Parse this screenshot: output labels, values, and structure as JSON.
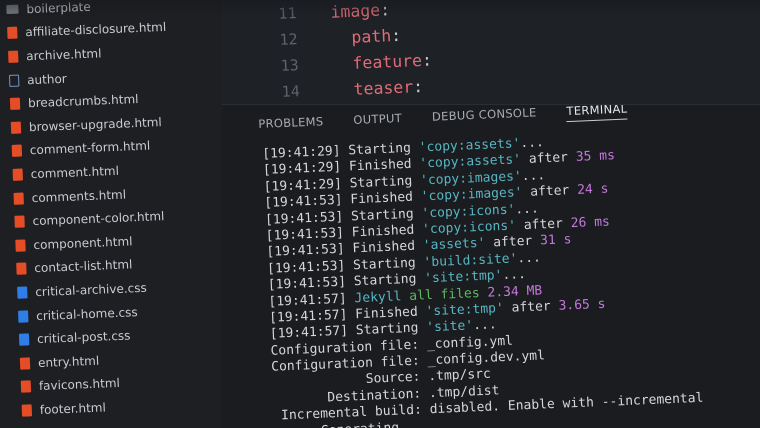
{
  "sidebar": {
    "files": [
      {
        "name": "boilerplate",
        "type": "folder"
      },
      {
        "name": "affiliate-disclosure.html",
        "type": "html"
      },
      {
        "name": "archive.html",
        "type": "html"
      },
      {
        "name": "author",
        "type": "file"
      },
      {
        "name": "breadcrumbs.html",
        "type": "html"
      },
      {
        "name": "browser-upgrade.html",
        "type": "html"
      },
      {
        "name": "comment-form.html",
        "type": "html"
      },
      {
        "name": "comment.html",
        "type": "html"
      },
      {
        "name": "comments.html",
        "type": "html"
      },
      {
        "name": "component-color.html",
        "type": "html"
      },
      {
        "name": "component.html",
        "type": "html"
      },
      {
        "name": "contact-list.html",
        "type": "html"
      },
      {
        "name": "critical-archive.css",
        "type": "css"
      },
      {
        "name": "critical-home.css",
        "type": "css"
      },
      {
        "name": "critical-post.css",
        "type": "css"
      },
      {
        "name": "entry.html",
        "type": "html"
      },
      {
        "name": "favicons.html",
        "type": "html"
      },
      {
        "name": "footer.html",
        "type": "html"
      }
    ]
  },
  "editor": {
    "lines": [
      {
        "num": "11",
        "key": "image",
        "indent": ""
      },
      {
        "num": "12",
        "key": "path",
        "indent": "  "
      },
      {
        "num": "13",
        "key": "feature",
        "indent": "  "
      },
      {
        "num": "14",
        "key": "teaser",
        "indent": "  "
      }
    ]
  },
  "panel": {
    "tabs": [
      {
        "label": "PROBLEMS",
        "active": false
      },
      {
        "label": "OUTPUT",
        "active": false
      },
      {
        "label": "DEBUG CONSOLE",
        "active": false
      },
      {
        "label": "TERMINAL",
        "active": true
      }
    ],
    "terminal_lines": [
      [
        {
          "t": "[19:41:29] ",
          "c": "ts"
        },
        {
          "t": "Starting ",
          "c": "ts"
        },
        {
          "t": "'copy:assets'",
          "c": "task"
        },
        {
          "t": "...",
          "c": "ts"
        }
      ],
      [
        {
          "t": "[19:41:29] ",
          "c": "ts"
        },
        {
          "t": "Finished ",
          "c": "ts"
        },
        {
          "t": "'copy:assets'",
          "c": "task"
        },
        {
          "t": " after ",
          "c": "ts"
        },
        {
          "t": "35 ms",
          "c": "num"
        }
      ],
      [
        {
          "t": "[19:41:29] ",
          "c": "ts"
        },
        {
          "t": "Starting ",
          "c": "ts"
        },
        {
          "t": "'copy:images'",
          "c": "task"
        },
        {
          "t": "...",
          "c": "ts"
        }
      ],
      [
        {
          "t": "[19:41:53] ",
          "c": "ts"
        },
        {
          "t": "Finished ",
          "c": "ts"
        },
        {
          "t": "'copy:images'",
          "c": "task"
        },
        {
          "t": " after ",
          "c": "ts"
        },
        {
          "t": "24 s",
          "c": "num"
        }
      ],
      [
        {
          "t": "[19:41:53] ",
          "c": "ts"
        },
        {
          "t": "Starting ",
          "c": "ts"
        },
        {
          "t": "'copy:icons'",
          "c": "task"
        },
        {
          "t": "...",
          "c": "ts"
        }
      ],
      [
        {
          "t": "[19:41:53] ",
          "c": "ts"
        },
        {
          "t": "Finished ",
          "c": "ts"
        },
        {
          "t": "'copy:icons'",
          "c": "task"
        },
        {
          "t": " after ",
          "c": "ts"
        },
        {
          "t": "26 ms",
          "c": "num"
        }
      ],
      [
        {
          "t": "[19:41:53] ",
          "c": "ts"
        },
        {
          "t": "Finished ",
          "c": "ts"
        },
        {
          "t": "'assets'",
          "c": "task"
        },
        {
          "t": " after ",
          "c": "ts"
        },
        {
          "t": "31 s",
          "c": "num"
        }
      ],
      [
        {
          "t": "[19:41:53] ",
          "c": "ts"
        },
        {
          "t": "Starting ",
          "c": "ts"
        },
        {
          "t": "'build:site'",
          "c": "task"
        },
        {
          "t": "...",
          "c": "ts"
        }
      ],
      [
        {
          "t": "[19:41:53] ",
          "c": "ts"
        },
        {
          "t": "Starting ",
          "c": "ts"
        },
        {
          "t": "'site:tmp'",
          "c": "task"
        },
        {
          "t": "...",
          "c": "ts"
        }
      ],
      [
        {
          "t": "[19:41:57] ",
          "c": "ts"
        },
        {
          "t": "Jekyll ",
          "c": "task"
        },
        {
          "t": "all files ",
          "c": "green"
        },
        {
          "t": "2.34 MB",
          "c": "num"
        }
      ],
      [
        {
          "t": "[19:41:57] ",
          "c": "ts"
        },
        {
          "t": "Finished ",
          "c": "ts"
        },
        {
          "t": "'site:tmp'",
          "c": "task"
        },
        {
          "t": " after ",
          "c": "ts"
        },
        {
          "t": "3.65 s",
          "c": "num"
        }
      ],
      [
        {
          "t": "[19:41:57] ",
          "c": "ts"
        },
        {
          "t": "Starting ",
          "c": "ts"
        },
        {
          "t": "'site'",
          "c": "task"
        },
        {
          "t": "...",
          "c": "ts"
        }
      ],
      [
        {
          "t": "Configuration file: _config.yml",
          "c": "ts"
        }
      ],
      [
        {
          "t": "Configuration file: _config.dev.yml",
          "c": "ts"
        }
      ],
      [
        {
          "t": "            Source: .tmp/src",
          "c": "ts"
        }
      ],
      [
        {
          "t": "       Destination: .tmp/dist",
          "c": "ts"
        }
      ],
      [
        {
          "t": " Incremental build: disabled. Enable with --incremental",
          "c": "ts"
        }
      ],
      [
        {
          "t": "      Generating...",
          "c": "ts"
        }
      ]
    ]
  },
  "colors": {
    "background": "#16181c",
    "task": "#56b6c2",
    "number": "#c678dd",
    "key": "#e06c75",
    "green": "#5fb760"
  }
}
